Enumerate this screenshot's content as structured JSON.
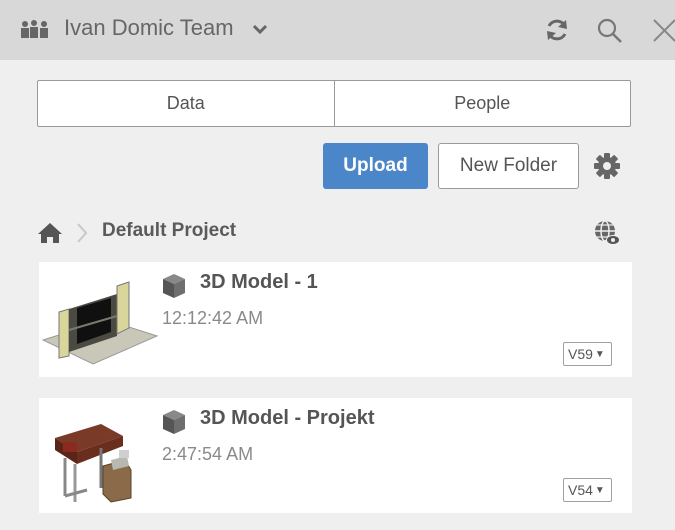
{
  "header": {
    "team_name": "Ivan Domic Team"
  },
  "tabs": {
    "data_label": "Data",
    "people_label": "People"
  },
  "toolbar": {
    "upload_label": "Upload",
    "new_folder_label": "New Folder"
  },
  "breadcrumb": {
    "project": "Default Project"
  },
  "models": [
    {
      "name": "3D Model - 1",
      "time": "12:12:42 AM",
      "version": "V59"
    },
    {
      "name": "3D Model - Projekt",
      "time": "2:47:54 AM",
      "version": "V54"
    }
  ],
  "icons": {
    "team": "team-icon",
    "chevron": "chevron-down-icon",
    "refresh": "refresh-icon",
    "search": "search-icon",
    "close": "close-icon",
    "settings": "gear-icon",
    "home": "home-icon",
    "globe": "globe-icon",
    "model": "cube-icon"
  },
  "colors": {
    "header_bg": "#d8d8d8",
    "upload_bg": "#4a86c8",
    "panel_bg": "#efefef"
  }
}
